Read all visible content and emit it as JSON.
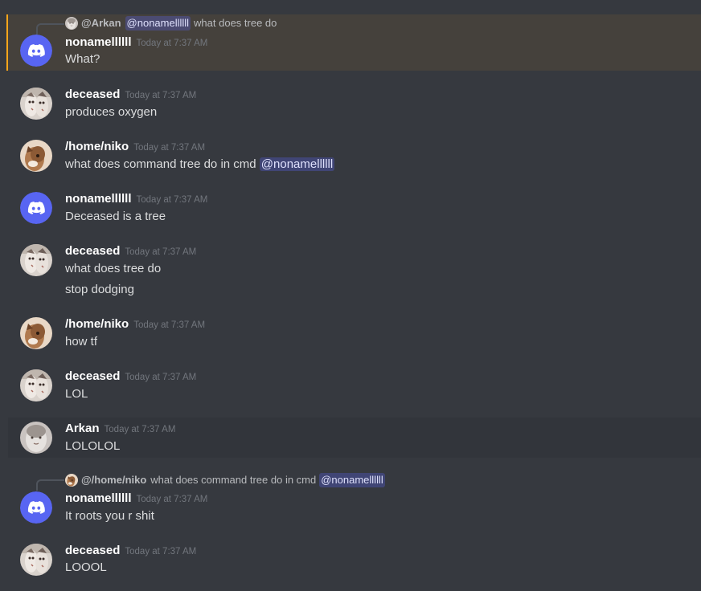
{
  "colors": {
    "background": "#36393f",
    "highlight_border": "#faa61a",
    "discord_blurple": "#5865f2",
    "mention_bg": "#414675"
  },
  "messages": [
    {
      "reply": {
        "name": "@Arkan",
        "mention": "@nonamellllll",
        "text": "what does tree do",
        "avatar": "arkan-avatar"
      },
      "author": "nonamellllll",
      "timestamp": "Today at 7:37 AM",
      "avatar": "discord-logo-icon",
      "lines": [
        "What?"
      ]
    },
    {
      "author": "deceased",
      "timestamp": "Today at 7:37 AM",
      "avatar": "deceased-avatar",
      "lines": [
        "produces oxygen"
      ]
    },
    {
      "author": "/home/niko",
      "timestamp": "Today at 7:37 AM",
      "avatar": "niko-avatar",
      "lines": [
        "what does command tree do in cmd"
      ],
      "mention": "@nonamellllll"
    },
    {
      "author": "nonamellllll",
      "timestamp": "Today at 7:37 AM",
      "avatar": "discord-logo-icon",
      "lines": [
        "Deceased is a tree"
      ]
    },
    {
      "author": "deceased",
      "timestamp": "Today at 7:37 AM",
      "avatar": "deceased-avatar",
      "lines": [
        "what does tree do",
        "stop dodging"
      ]
    },
    {
      "author": "/home/niko",
      "timestamp": "Today at 7:37 AM",
      "avatar": "niko-avatar",
      "lines": [
        "how tf"
      ]
    },
    {
      "author": "deceased",
      "timestamp": "Today at 7:37 AM",
      "avatar": "deceased-avatar",
      "lines": [
        "LOL"
      ]
    },
    {
      "author": "Arkan",
      "timestamp": "Today at 7:37 AM",
      "avatar": "arkan-avatar",
      "lines": [
        "LOLOLOL"
      ]
    },
    {
      "reply": {
        "name": "@/home/niko",
        "text": "what does command tree do in cmd",
        "mention": "@nonamellllll",
        "avatar": "niko-avatar"
      },
      "author": "nonamellllll",
      "timestamp": "Today at 7:37 AM",
      "avatar": "discord-logo-icon",
      "lines": [
        "It roots you r shit"
      ]
    },
    {
      "author": "deceased",
      "timestamp": "Today at 7:37 AM",
      "avatar": "deceased-avatar",
      "lines": [
        "LOOOL"
      ]
    }
  ]
}
